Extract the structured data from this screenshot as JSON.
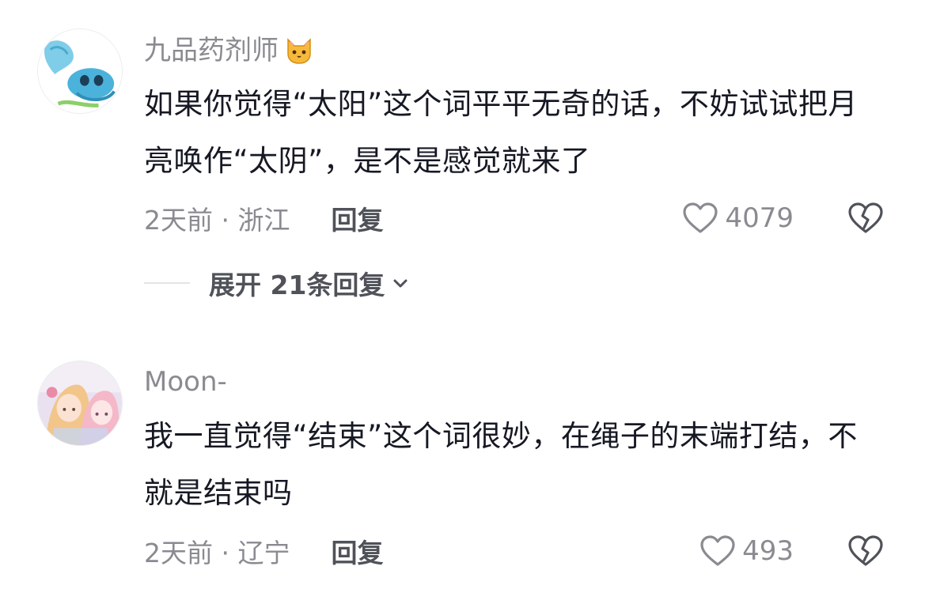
{
  "comments": [
    {
      "username": "九品药剂师",
      "username_emoji": "cat-face-emoji",
      "text": "如果你觉得“太阳”这个词平平无奇的话，不妨试试把月亮唤作“太阴”，是不是感觉就来了",
      "meta": "2天前 · 浙江",
      "reply_label": "回复",
      "likes": "4079",
      "expand_label": "展开 21条回复"
    },
    {
      "username": "Moon-",
      "text": "我一直觉得“结束”这个词很妙，在绳子的末端打结，不就是结束吗",
      "meta": "2天前 · 辽宁",
      "reply_label": "回复",
      "likes": "493"
    }
  ],
  "colors": {
    "text_primary": "#161823",
    "text_secondary": "#8a8b91",
    "text_action": "#505259"
  },
  "icons": {
    "like": "heart-outline-icon",
    "dislike": "broken-heart-icon",
    "expand": "chevron-down-icon"
  }
}
